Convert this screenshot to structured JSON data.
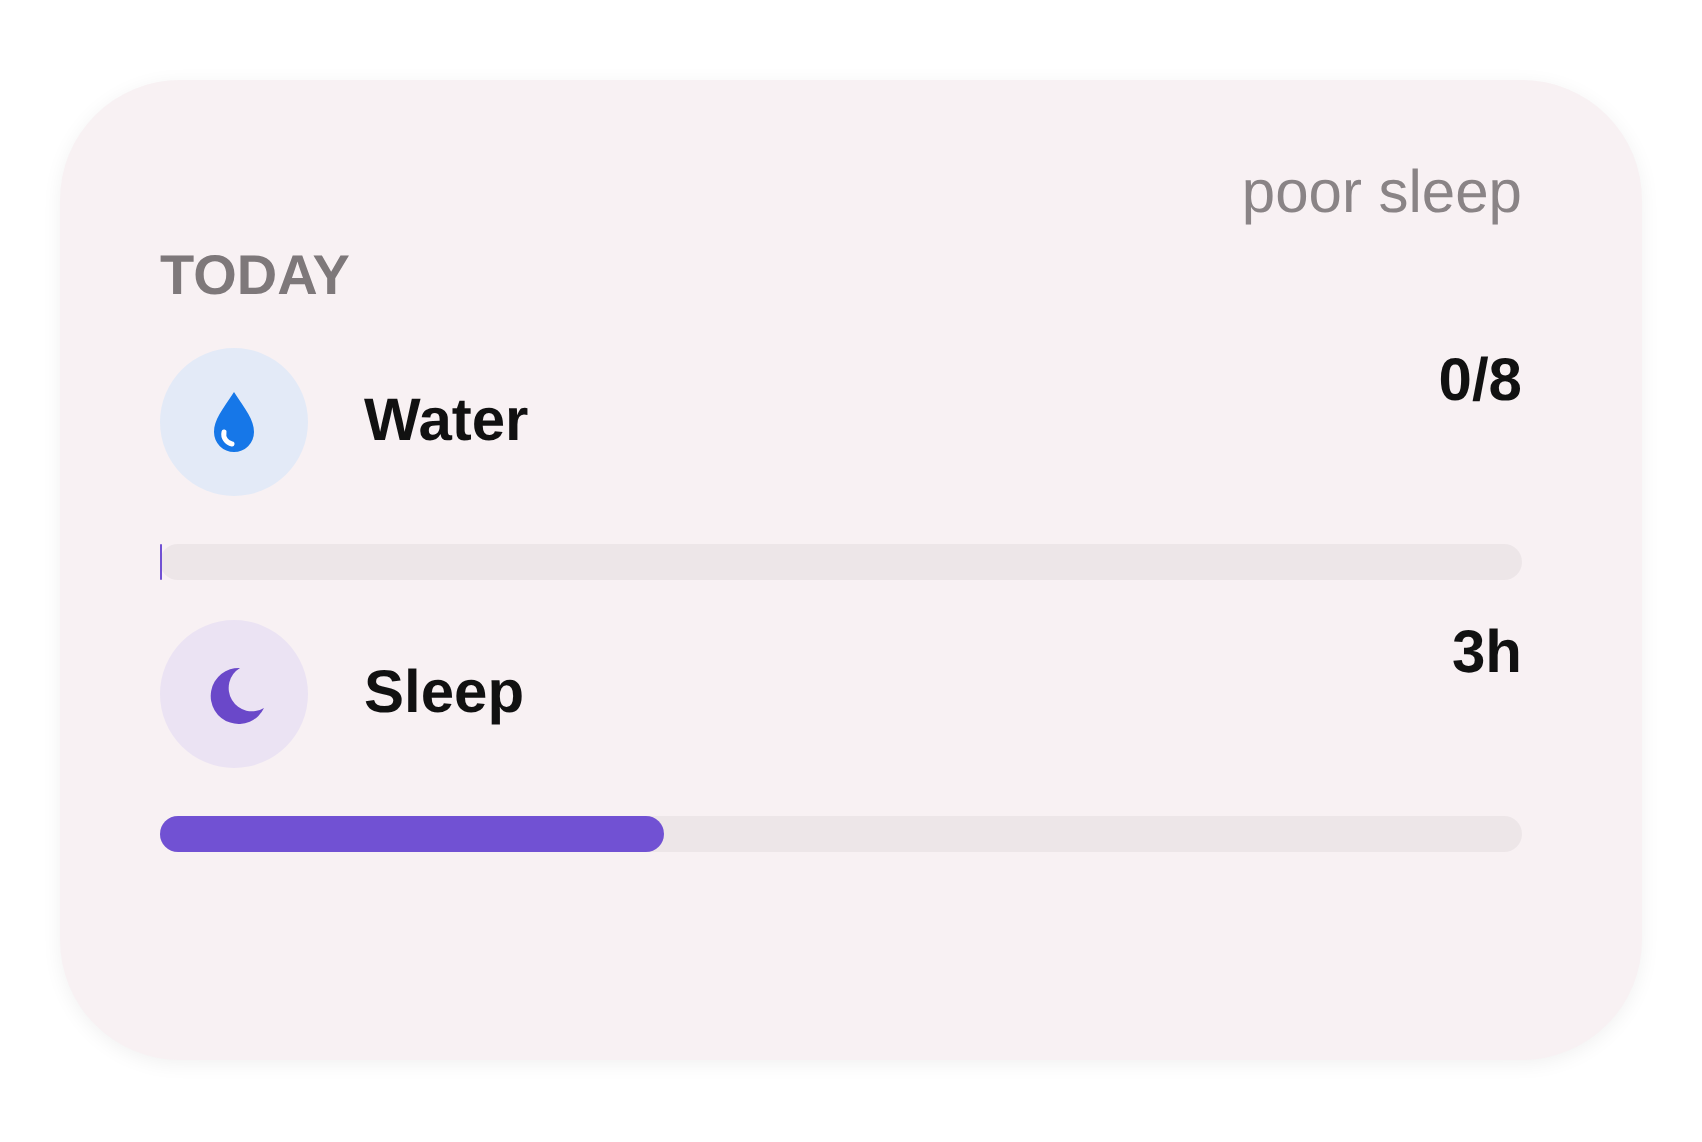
{
  "status": "poor sleep",
  "heading": "TODAY",
  "trackers": [
    {
      "kind": "water",
      "label": "Water",
      "reading": "0/8",
      "level": 0
    },
    {
      "kind": "sleep",
      "label": "Sleep",
      "reading": "3h",
      "level": 0.37
    }
  ]
}
